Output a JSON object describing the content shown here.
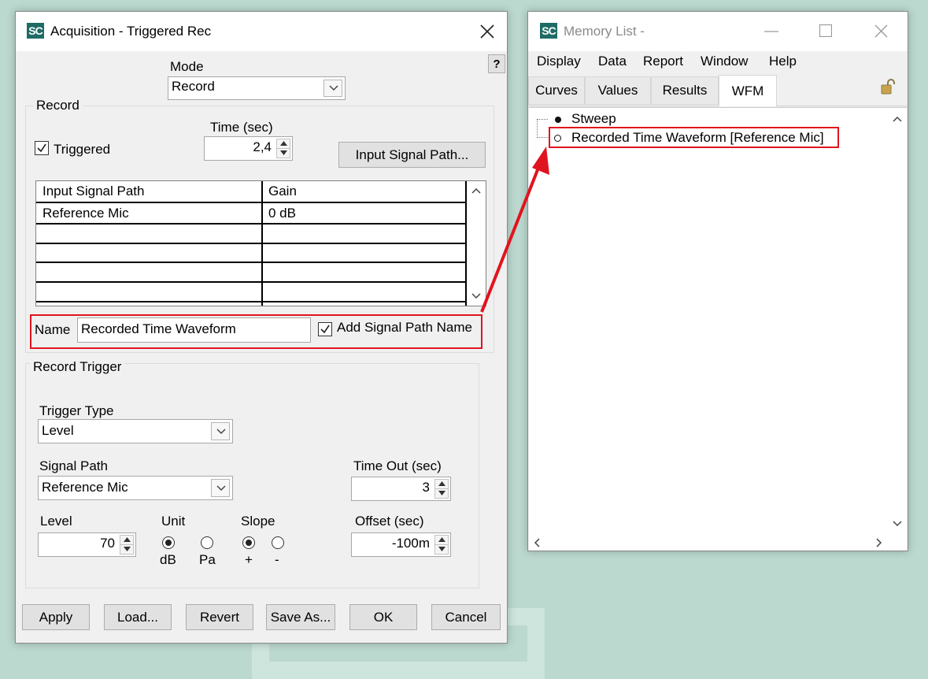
{
  "acquisition": {
    "title": "Acquisition  - Triggered Rec",
    "help": "?",
    "mode": {
      "label": "Mode",
      "value": "Record"
    },
    "record": {
      "group_label": "Record",
      "triggered_label": "Triggered",
      "triggered": true,
      "time_label": "Time (sec)",
      "time_value": "2,4",
      "input_signal_path_button": "Input Signal Path...",
      "table": {
        "columns": [
          "Input Signal Path",
          "Gain"
        ],
        "rows": [
          [
            "Reference Mic",
            "0 dB"
          ]
        ]
      },
      "name_label": "Name",
      "name_value": "Recorded Time Waveform",
      "add_signal_path_name_label": "Add Signal Path Name",
      "add_signal_path_name": true
    },
    "trigger": {
      "group_label": "Record Trigger",
      "trigger_type_label": "Trigger Type",
      "trigger_type_value": "Level",
      "signal_path_label": "Signal Path",
      "signal_path_value": "Reference Mic",
      "timeout_label": "Time Out (sec)",
      "timeout_value": "3",
      "level_label": "Level",
      "level_value": "70",
      "unit_label": "Unit",
      "unit_options": [
        "dB",
        "Pa"
      ],
      "unit_selected": "dB",
      "slope_label": "Slope",
      "slope_options": [
        "+",
        "-"
      ],
      "slope_selected": "+",
      "offset_label": "Offset (sec)",
      "offset_value": "-100m"
    },
    "buttons": {
      "apply": "Apply",
      "load": "Load...",
      "revert": "Revert",
      "save_as": "Save As...",
      "ok": "OK",
      "cancel": "Cancel"
    }
  },
  "memory_list": {
    "title": "Memory List -",
    "menu": [
      "Display",
      "Data",
      "Report",
      "Window",
      "Help"
    ],
    "tabs": [
      "Curves",
      "Values",
      "Results",
      "WFM"
    ],
    "active_tab": "WFM",
    "items": [
      "Stweep",
      "Recorded Time Waveform [Reference Mic]"
    ]
  },
  "colors": {
    "highlight": "#e0141e",
    "logo": "#1f6b66",
    "desktop": "#bcd9cf"
  },
  "icons": [
    "sc-logo-icon",
    "close-icon",
    "minimize-icon",
    "maximize-icon",
    "lock-icon",
    "chevron-down-icon",
    "chevron-up-icon"
  ]
}
